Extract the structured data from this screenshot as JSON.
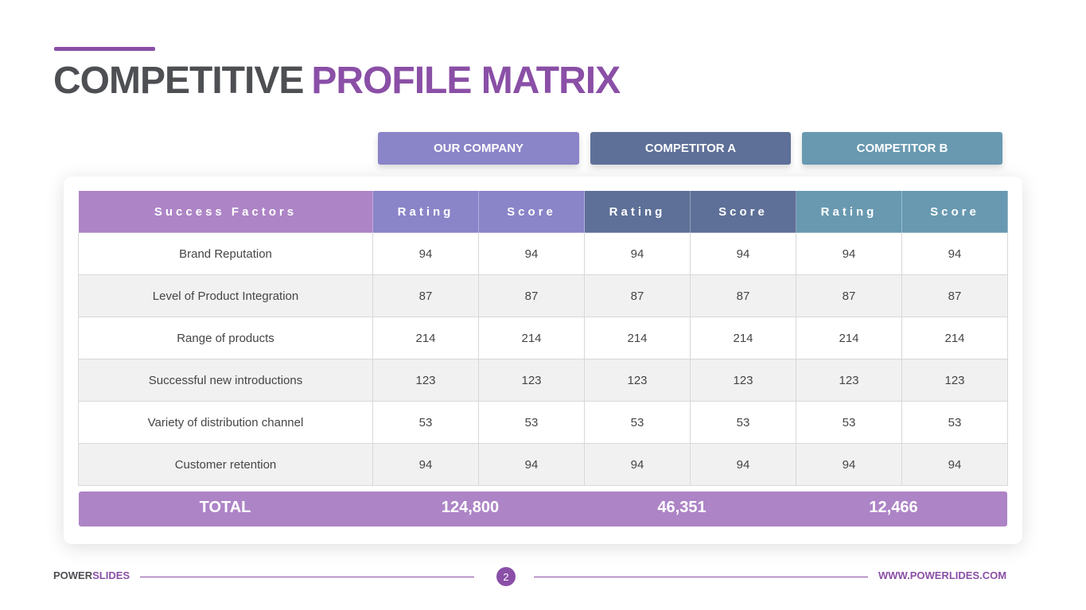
{
  "title": {
    "part1": "COMPETITIVE",
    "part2": "PROFILE MATRIX"
  },
  "column_groups": [
    "OUR COMPANY",
    "COMPETITOR A",
    "COMPETITOR B"
  ],
  "table": {
    "headers": [
      "Success Factors",
      "Rating",
      "Score",
      "Rating",
      "Score",
      "Rating",
      "Score"
    ],
    "rows": [
      [
        "Brand Reputation",
        "94",
        "94",
        "94",
        "94",
        "94",
        "94"
      ],
      [
        "Level of Product Integration",
        "87",
        "87",
        "87",
        "87",
        "87",
        "87"
      ],
      [
        "Range of products",
        "214",
        "214",
        "214",
        "214",
        "214",
        "214"
      ],
      [
        "Successful new introductions",
        "123",
        "123",
        "123",
        "123",
        "123",
        "123"
      ],
      [
        "Variety of distribution channel",
        "53",
        "53",
        "53",
        "53",
        "53",
        "53"
      ],
      [
        "Customer retention",
        "94",
        "94",
        "94",
        "94",
        "94",
        "94"
      ]
    ]
  },
  "totals": {
    "label": "TOTAL",
    "values": [
      "124,800",
      "46,351",
      "12,466"
    ]
  },
  "footer": {
    "brand_part1": "POWER",
    "brand_part2": "SLIDES",
    "page_number": "2",
    "url": "WWW.POWERLIDES.COM"
  }
}
